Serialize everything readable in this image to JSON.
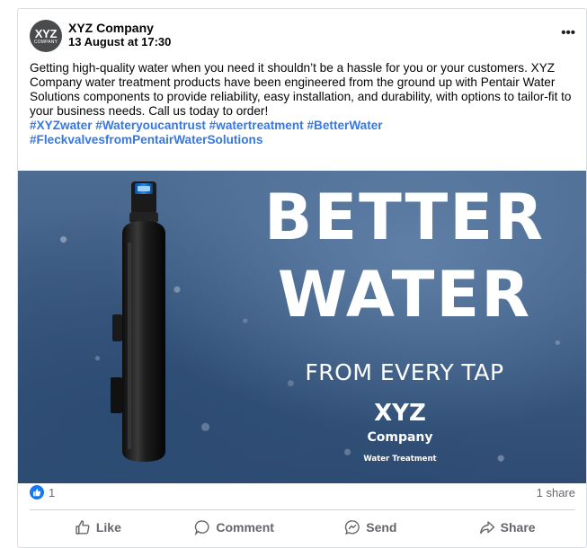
{
  "post": {
    "author": "XYZ Company",
    "avatar": {
      "line1": "XYZ",
      "line2": "COMPANY"
    },
    "timestamp": "13 August at 17:30",
    "more_label": "•••",
    "message": "Getting high-quality water when you need it shouldn’t be a hassle for you or your customers. XYZ Company water treatment products have been engineered from the ground up with Pentair Water Solutions components to provide reliability, easy installation, and durability, with options to tailor-fit to your business needs. Call us today to order!",
    "hashtags_line1": "#XYZwater #Wateryoucantrust #watertreatment #BetterWater",
    "hashtags_line2": "#FleckvalvesfromPentairWaterSolutions"
  },
  "media": {
    "headline_1": "BETTER",
    "headline_2": "WATER",
    "subheadline": "FROM EVERY TAP",
    "brand_name": "XYZ",
    "brand_sub": "Company",
    "brand_tagline": "Water Treatment"
  },
  "stats": {
    "reaction_count": "1",
    "share_count": "1 share"
  },
  "actions": {
    "like": "Like",
    "comment": "Comment",
    "send": "Send",
    "share": "Share"
  },
  "colors": {
    "hashtag": "#3578e5",
    "like_badge": "#1877f2",
    "muted_text": "#65676b",
    "tank_cap": "#1e6fd0"
  },
  "icons": {
    "like": "thumbs-up-icon",
    "comment": "comment-bubble-icon",
    "send": "messenger-icon",
    "share": "share-arrow-icon",
    "more": "more-dots-icon"
  }
}
